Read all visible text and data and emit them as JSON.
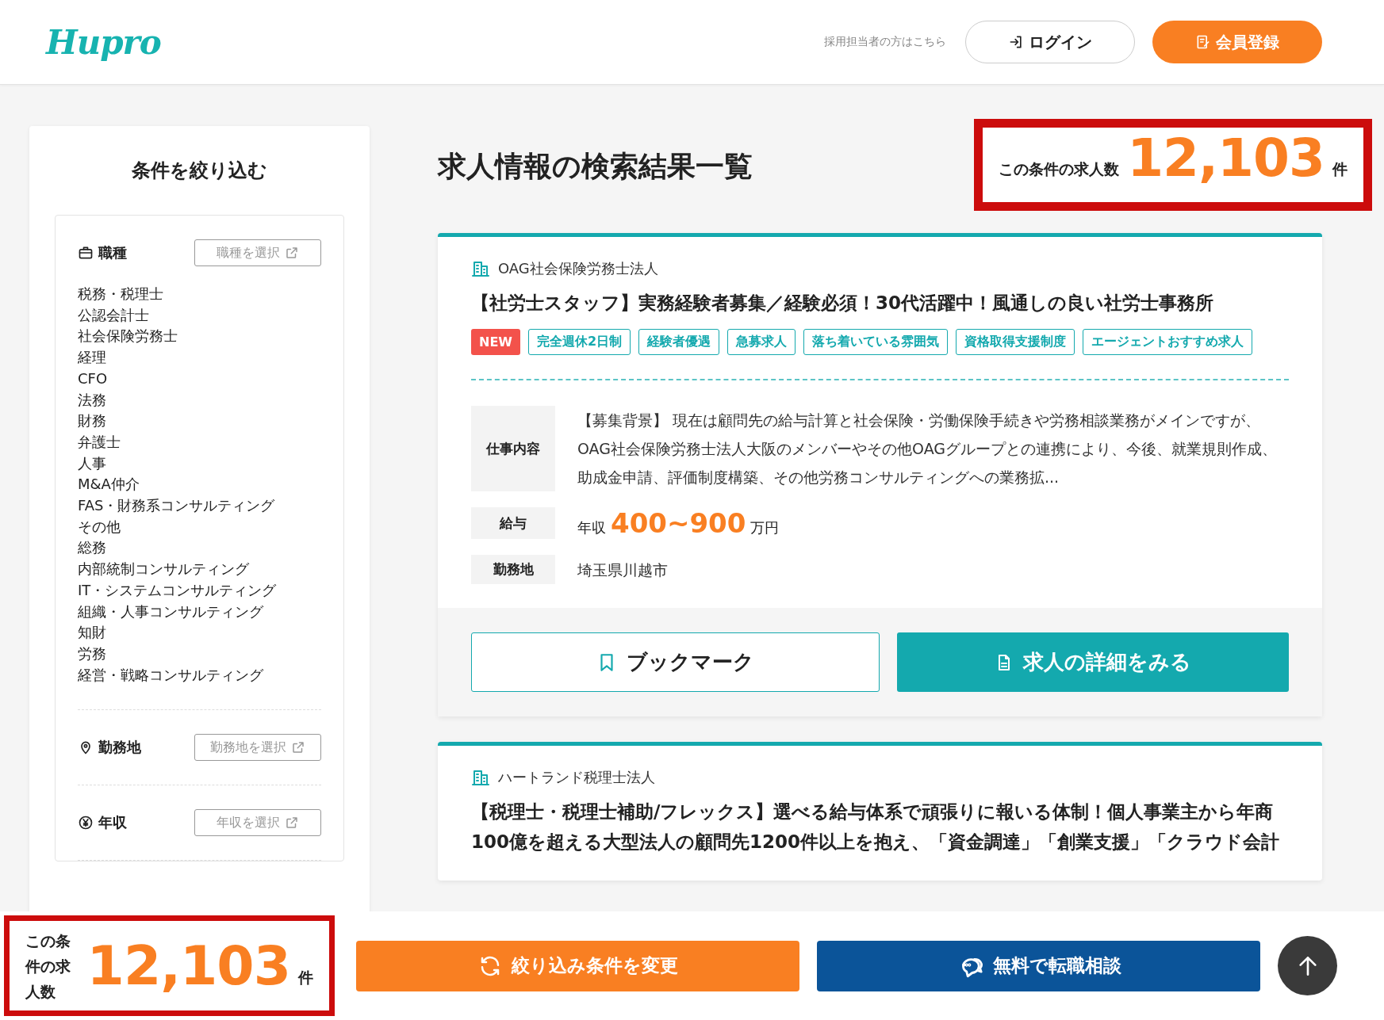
{
  "header": {
    "logo": "Hupro",
    "recruiter_link": "採用担当者の方はこちら",
    "login_button": "ログイン",
    "register_button": "会員登録"
  },
  "filter_panel": {
    "title": "条件を絞り込む",
    "sections": [
      {
        "kind": "job_type",
        "label": "職種",
        "button": "職種を選択",
        "items": [
          "税務・税理士",
          "公認会計士",
          "社会保険労務士",
          "経理",
          "CFO",
          "法務",
          "財務",
          "弁護士",
          "人事",
          "M&A仲介",
          "FAS・財務系コンサルティング",
          "その他",
          "総務",
          "内部統制コンサルティング",
          "IT・システムコンサルティング",
          "組織・人事コンサルティング",
          "知財",
          "労務",
          "経営・戦略コンサルティング"
        ]
      },
      {
        "kind": "location",
        "label": "勤務地",
        "button": "勤務地を選択"
      },
      {
        "kind": "salary",
        "label": "年収",
        "button": "年収を選択"
      }
    ]
  },
  "results": {
    "title": "求人情報の検索結果一覧",
    "count_label": "この条件の求人数",
    "count": "12,103",
    "count_unit": "件"
  },
  "jobs": [
    {
      "company": "OAG社会保険労務士法人",
      "title": "【社労士スタッフ】実務経験者募集／経験必須！30代活躍中！風通しの良い社労士事務所",
      "tags": [
        {
          "kind": "new",
          "label": "NEW"
        },
        {
          "kind": "feature",
          "label": "完全週休2日制"
        },
        {
          "kind": "feature",
          "label": "経験者優遇"
        },
        {
          "kind": "feature",
          "label": "急募求人"
        },
        {
          "kind": "feature",
          "label": "落ち着いている雰囲気"
        },
        {
          "kind": "feature",
          "label": "資格取得支援制度"
        },
        {
          "kind": "feature",
          "label": "エージェントおすすめ求人"
        }
      ],
      "details": [
        {
          "kind": "text",
          "label": "仕事内容",
          "value": "【募集背景】 現在は顧問先の給与計算と社会保険・労働保険手続きや労務相談業務がメインですが、OAG社会保険労務士法人大阪のメンバーやその他OAGグループとの連携により、今後、就業規則作成、助成金申請、評価制度構築、その他労務コンサルティングへの業務拡..."
        },
        {
          "kind": "salary",
          "label": "給与",
          "prefix": "年収",
          "value": "400~900",
          "unit": "万円"
        },
        {
          "kind": "text",
          "label": "勤務地",
          "value": "埼玉県川越市"
        }
      ],
      "bookmark_button": "ブックマーク",
      "detail_button": "求人の詳細をみる"
    },
    {
      "company": "ハートランド税理士法人",
      "title": "【税理士・税理士補助/フレックス】選べる給与体系で頑張りに報いる体制！個人事業主から年商100億を超える大型法人の顧問先1200件以上を抱え、「資金調達」「創業支援」「クラウド会計"
    }
  ],
  "bottom_bar": {
    "count_label": "この条件の求人数",
    "count": "12,103",
    "count_unit": "件",
    "change_button": "絞り込み条件を変更",
    "consult_button": "無料で転職相談"
  }
}
